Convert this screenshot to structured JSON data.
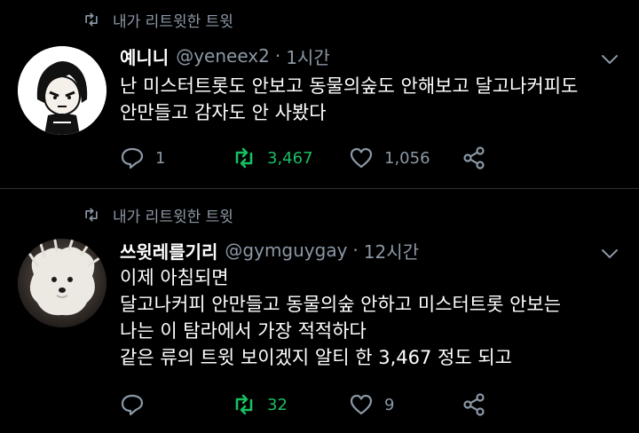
{
  "tweets": [
    {
      "retweet_label": "내가 리트윗한 트윗",
      "name": "예니니",
      "handle": "@yeneex2",
      "separator": "·",
      "time": "1시간",
      "lines": [
        "난 미스터트롯도 안보고 동물의숲도 안해보고 달고나커피도",
        "안만들고 감자도 안 사봤다"
      ],
      "reply_count": "1",
      "retweet_count": "3,467",
      "like_count": "1,056"
    },
    {
      "retweet_label": "내가 리트윗한 트윗",
      "name": "쓰윗레를기리",
      "handle": "@gymguygay",
      "separator": "·",
      "time": "12시간",
      "lines": [
        "이제 아침되면",
        "달고나커피 안만들고 동물의숲 안하고 미스터트롯 안보는",
        "나는 이 탐라에서 가장 적적하다",
        "같은 류의 트윗 보이겠지 알티 한 3,467 정도 되고"
      ],
      "reply_count": "",
      "retweet_count": "32",
      "like_count": "9"
    }
  ],
  "colors": {
    "background": "#000000",
    "text": "#ffffff",
    "muted": "#8b98a5",
    "retweet_active": "#17bf63",
    "divider": "#2f3336"
  },
  "icons": {
    "retweet": "retweet-icon",
    "reply": "reply-icon",
    "like": "heart-icon",
    "share": "share-icon",
    "more": "chevron-down-icon"
  }
}
